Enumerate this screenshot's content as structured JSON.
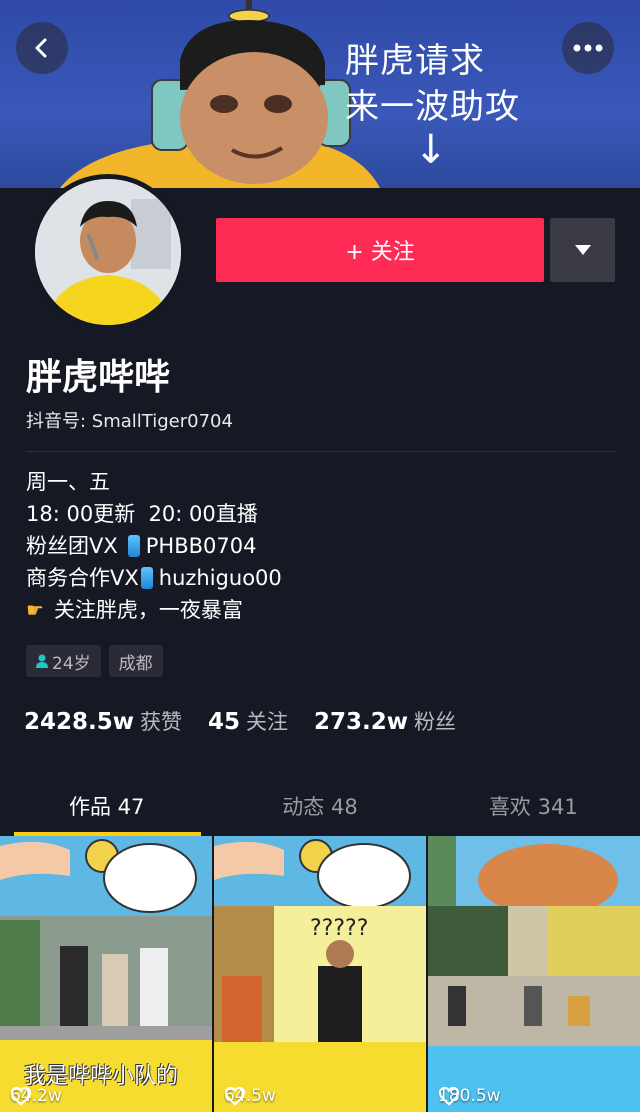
{
  "banner": {
    "caption_line1": "胖虎请求",
    "caption_line2": "来一波助攻",
    "arrow": "↓"
  },
  "nav": {
    "back_icon": "chevron-left-icon",
    "more_icon": "more-dots-icon"
  },
  "profile": {
    "follow_label": "+ 关注",
    "nickname": "胖虎哔哔",
    "douyin_id": "抖音号: SmallTiger0704",
    "bio": {
      "line1": "周一、五",
      "line2": "18: 00更新  20: 00直播",
      "line3_prefix": "粉丝团VX",
      "line3_value": "PHBB0704",
      "line4_prefix": "商务合作VX",
      "line4_value": "huzhiguo00",
      "line5": "关注胖虎，一夜暴富"
    },
    "tags": {
      "age": "24岁",
      "city": "成都"
    },
    "stats": {
      "likes_num": "2428.5w",
      "likes_label": "获赞",
      "following_num": "45",
      "following_label": "关注",
      "fans_num": "273.2w",
      "fans_label": "粉丝"
    }
  },
  "tabs": {
    "works": "作品 47",
    "dynamic": "动态 48",
    "favorites": "喜欢 341"
  },
  "videos": [
    {
      "likes": "64.2w",
      "caption": "我是哔哔小队的"
    },
    {
      "likes": "64.5w",
      "overlay_text": "?????"
    },
    {
      "likes": "180.5w"
    }
  ],
  "colors": {
    "background": "#161823",
    "follow_button": "#fe2c55",
    "tab_indicator": "#face15"
  }
}
